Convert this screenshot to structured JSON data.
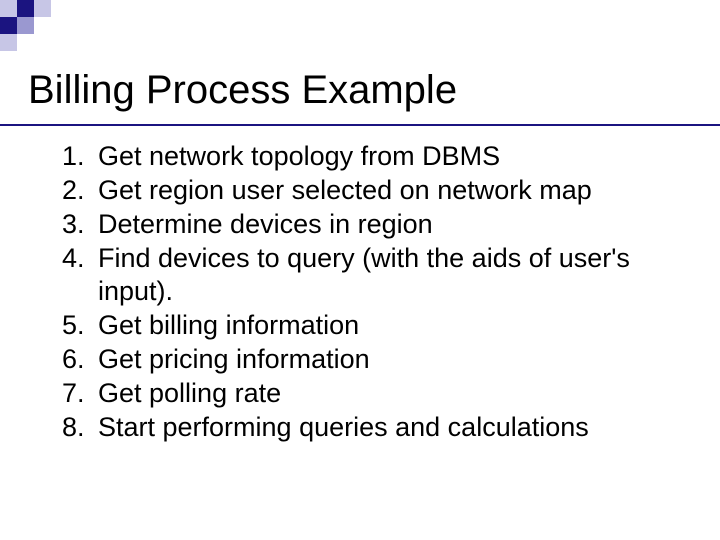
{
  "title": "Billing Process Example",
  "items": [
    {
      "n": "1.",
      "t": "Get network topology from DBMS"
    },
    {
      "n": "2.",
      "t": "Get region user selected on network map"
    },
    {
      "n": "3.",
      "t": "Determine devices in region"
    },
    {
      "n": "4.",
      "t": "Find devices to query (with the aids of user's input)."
    },
    {
      "n": "5.",
      "t": "Get billing information"
    },
    {
      "n": "6.",
      "t": "Get pricing information"
    },
    {
      "n": "7.",
      "t": "Get polling rate"
    },
    {
      "n": "8.",
      "t": "Start performing queries and calculations"
    }
  ],
  "accent": "#1b1480",
  "sq_light": "#c7c6e6",
  "sq_mid": "#9a98d0"
}
